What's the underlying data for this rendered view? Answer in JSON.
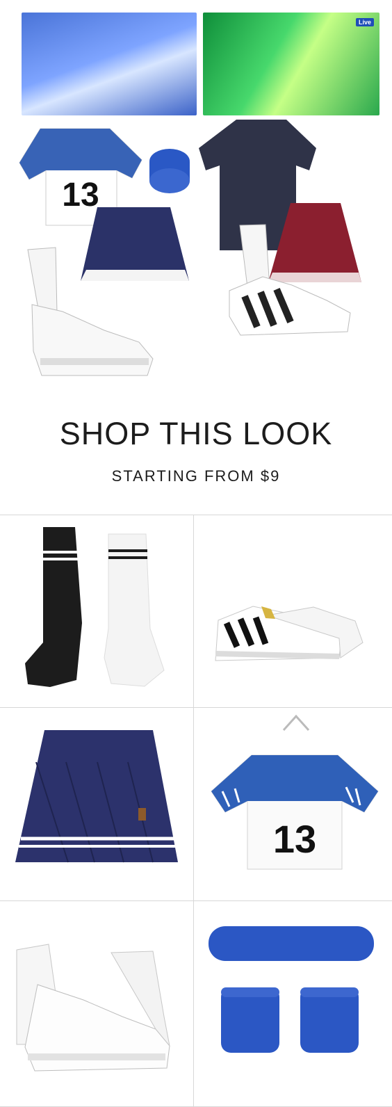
{
  "collage": {
    "live_badge": "Live"
  },
  "shop": {
    "headline": "SHOP THIS LOOK",
    "subline": "STARTING FROM $9"
  },
  "products": [
    {
      "name": "socks",
      "icon": "socks-icon"
    },
    {
      "name": "sneakers",
      "icon": "sneakers-icon"
    },
    {
      "name": "skirt",
      "icon": "skirt-icon"
    },
    {
      "name": "jersey",
      "icon": "jersey-icon"
    },
    {
      "name": "sneakers",
      "icon": "sneakers-icon"
    },
    {
      "name": "headband-wristbands",
      "icon": "headband-icon"
    }
  ],
  "jersey_number": "13",
  "colors": {
    "navy": "#2f3575",
    "blue": "#2f5fb7",
    "burgundy": "#8b1f2f"
  }
}
